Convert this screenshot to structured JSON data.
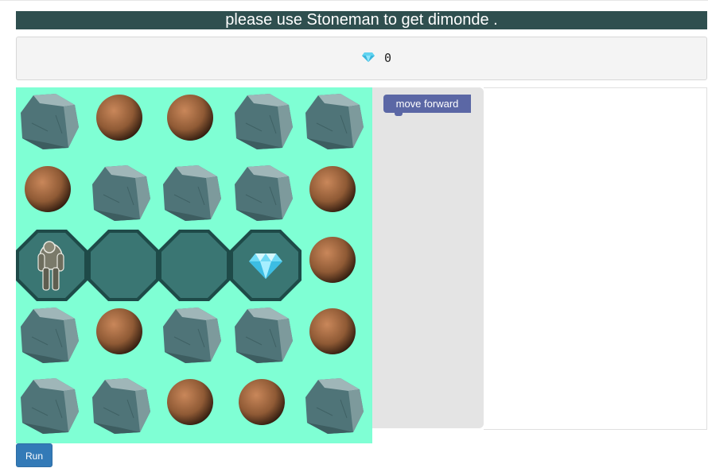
{
  "header": {
    "instruction": "please use Stoneman to get dimonde ."
  },
  "score": {
    "icon": "diamond-icon",
    "value": "0"
  },
  "board": {
    "grid": [
      [
        "rock",
        "boulder",
        "boulder",
        "rock",
        "rock"
      ],
      [
        "boulder",
        "rock",
        "rock",
        "rock",
        "boulder"
      ],
      [
        "stoneman",
        "path",
        "path",
        "diamond",
        "boulder"
      ],
      [
        "rock",
        "boulder",
        "rock",
        "rock",
        "boulder"
      ],
      [
        "rock",
        "rock",
        "boulder",
        "boulder",
        "rock"
      ]
    ]
  },
  "toolbox": {
    "blocks": [
      {
        "label": "move forward"
      }
    ]
  },
  "controls": {
    "run_label": "Run"
  },
  "colors": {
    "banner": "#2f4f4f",
    "board_bg": "#7fffd4",
    "path_tile": "#3a7673",
    "block": "#5b67a5",
    "run_button": "#337ab7"
  }
}
